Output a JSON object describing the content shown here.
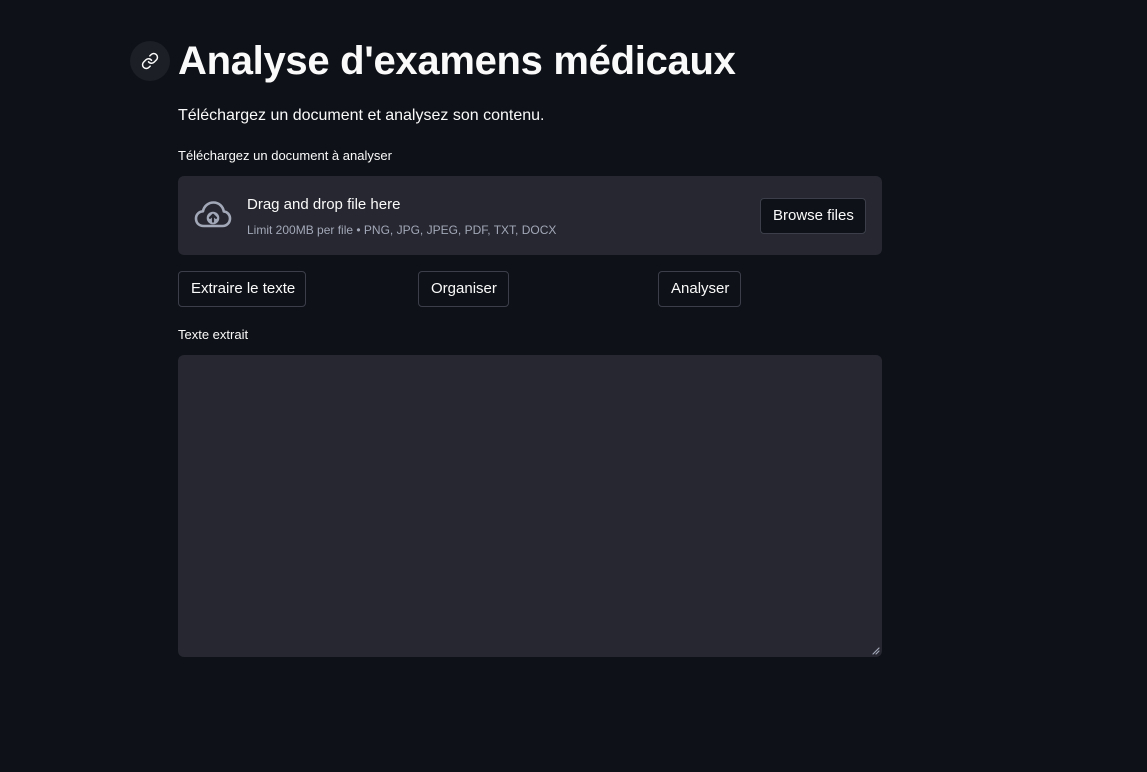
{
  "header": {
    "title": "Analyse d'examens médicaux",
    "anchor_icon": "link-icon"
  },
  "intro": {
    "text": "Téléchargez un document et analysez son contenu."
  },
  "uploader": {
    "label": "Téléchargez un document à analyser",
    "dropzone_title": "Drag and drop file here",
    "dropzone_limit": "Limit 200MB per file • PNG, JPG, JPEG, PDF, TXT, DOCX",
    "browse_label": "Browse files",
    "icon": "cloud-upload-icon"
  },
  "actions": {
    "extract_label": "Extraire le texte",
    "organize_label": "Organiser",
    "analyze_label": "Analyser"
  },
  "extracted": {
    "label": "Texte extrait",
    "value": ""
  },
  "colors": {
    "background": "#0e1117",
    "surface": "#262730",
    "text": "#fafafa",
    "muted_text": "#a3a8b8",
    "button_border": "#3c3f4a"
  }
}
